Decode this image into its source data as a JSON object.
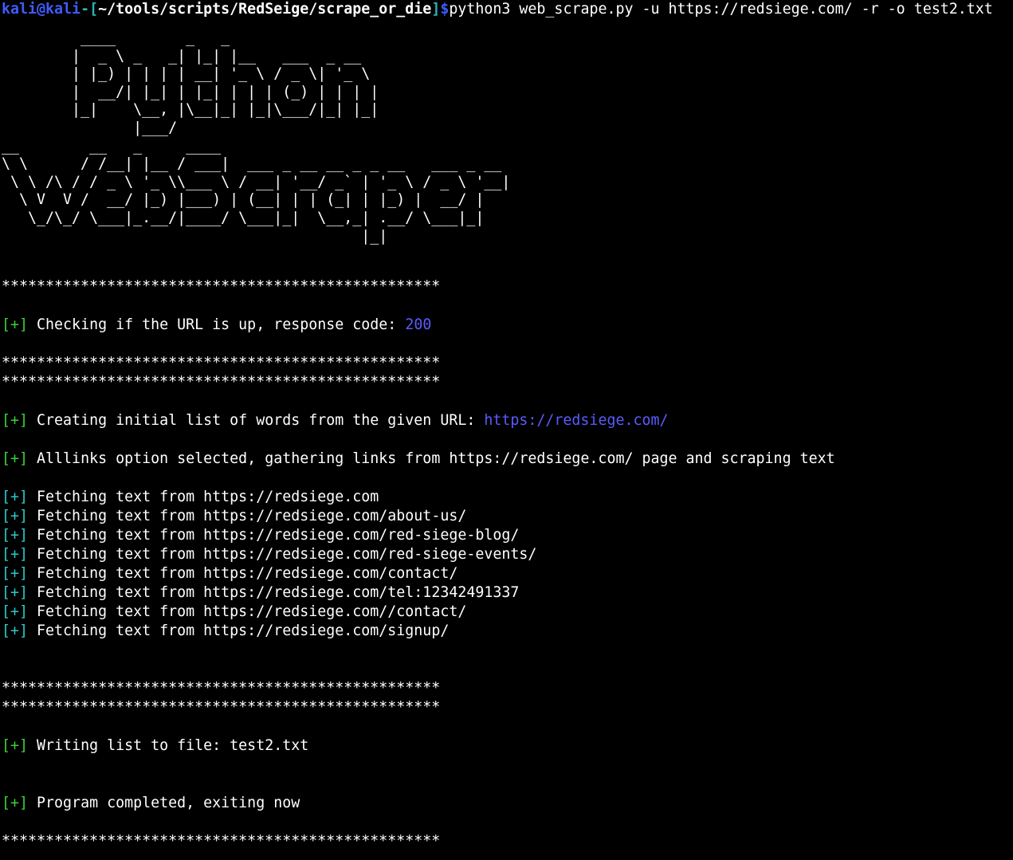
{
  "prompt": {
    "user_host": "kali@kali",
    "bracket_open": "-[",
    "path": "~/tools/scripts/RedSeige/scrape_or_die",
    "bracket_close": "]",
    "dollar": "$",
    "command": "python3 web_scrape.py -u https://redsiege.com/ -r -o test2.txt"
  },
  "banner": {
    "lines": [
      "         ____        _   _",
      "        |  _ \\ _   _| |_| |__   ___  _ __",
      "        | |_) | | | | __| '_ \\ / _ \\| '_ \\",
      "        |  __/| |_| | |_| | | | (_) | | | |",
      "        |_|    \\__, |\\__|_| |_|\\___/|_| |_|",
      "               |___/",
      "__        __   _     ____",
      "\\ \\      / /__| |__ / ___|  ___ _ __ __ _ _ __   ___ _ __",
      " \\ \\ /\\ / / _ \\ '_ \\\\___ \\ / __| '__/ _` | '_ \\ / _ \\ '__|",
      "  \\ V  V /  __/ |_) |___) | (__| | | (_| | |_) |  __/ |",
      "   \\_/\\_/ \\___|_.__/|____/ \\___|_|  \\__,_| .__/ \\___|_|",
      "                                         |_|"
    ]
  },
  "separator": "**************************************************",
  "status_up": {
    "tag": "[+]",
    "text": " Checking if the URL is up, response code: ",
    "code": "200"
  },
  "initial_list": {
    "tag": "[+]",
    "text": " Creating initial list of words from the given URL: ",
    "url": "https://redsiege.com/"
  },
  "alllinks": {
    "tag": "[+]",
    "text": " Alllinks option selected, gathering links from https://redsiege.com/ page and scraping text"
  },
  "fetch": {
    "tag": "[+]",
    "items": [
      " Fetching text from https://redsiege.com",
      " Fetching text from https://redsiege.com/about-us/",
      " Fetching text from https://redsiege.com/red-siege-blog/",
      " Fetching text from https://redsiege.com/red-siege-events/",
      " Fetching text from https://redsiege.com/contact/",
      " Fetching text from https://redsiege.com/tel:12342491337",
      " Fetching text from https://redsiege.com//contact/",
      " Fetching text from https://redsiege.com/signup/"
    ]
  },
  "writing": {
    "tag": "[+]",
    "text": " Writing list to file: test2.txt"
  },
  "completed": {
    "tag": "[+]",
    "text": " Program completed, exiting now"
  },
  "colors": {
    "background": "#000000",
    "prompt_user": "#3f5cff",
    "prompt_bracket": "#2bb3b3",
    "tag_green": "#3ad13a",
    "tag_cyan": "#2dc8c8",
    "value_blue": "#5b5bff",
    "text": "#ffffff"
  }
}
